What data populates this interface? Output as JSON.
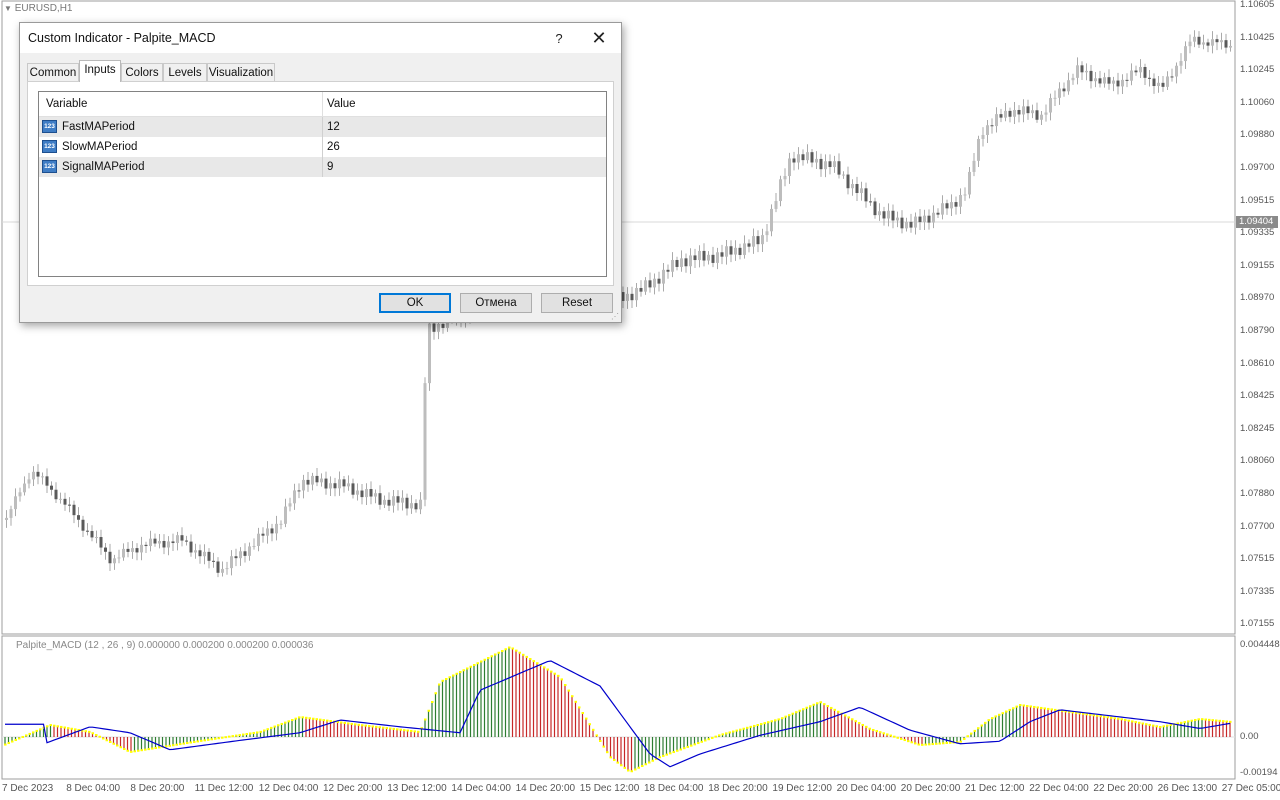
{
  "chart": {
    "symbol": "EURUSD,H1",
    "current_price": "1.09404",
    "price_ticks": [
      "1.10605",
      "1.10425",
      "1.10245",
      "1.10060",
      "1.09880",
      "1.09700",
      "1.09515",
      "1.09335",
      "1.09155",
      "1.08970",
      "1.08790",
      "1.08610",
      "1.08425",
      "1.08245",
      "1.08060",
      "1.07880",
      "1.07700",
      "1.07515",
      "1.07335",
      "1.07155"
    ],
    "time_ticks": [
      "7 Dec 2023",
      "8 Dec 04:00",
      "8 Dec 20:00",
      "11 Dec 12:00",
      "12 Dec 04:00",
      "12 Dec 20:00",
      "13 Dec 12:00",
      "14 Dec 04:00",
      "14 Dec 20:00",
      "15 Dec 12:00",
      "18 Dec 04:00",
      "18 Dec 20:00",
      "19 Dec 12:00",
      "20 Dec 04:00",
      "20 Dec 20:00",
      "21 Dec 12:00",
      "22 Dec 04:00",
      "22 Dec 20:00",
      "26 Dec 13:00",
      "27 Dec 05:00"
    ]
  },
  "indicator": {
    "label": "Palpite_MACD   (12 , 26 , 9) 0.000000 0.000200 0.000200 0.000036",
    "ticks": [
      "0.004448",
      "0.00",
      "-0.00194"
    ],
    "colors": {
      "up_bar": "#2e7d32",
      "down_bar": "#c62828",
      "edge": "#ffff00",
      "signal": "#0000cc"
    }
  },
  "dialog": {
    "title": "Custom Indicator - Palpite_MACD",
    "help_label": "?",
    "close_label": "✕",
    "tabs": [
      "Common",
      "Inputs",
      "Colors",
      "Levels",
      "Visualization"
    ],
    "active_tab": "Inputs",
    "columns": {
      "variable": "Variable",
      "value": "Value"
    },
    "rows": [
      {
        "icon": "123",
        "variable": "FastMAPeriod",
        "value": "12"
      },
      {
        "icon": "123",
        "variable": "SlowMAPeriod",
        "value": "26"
      },
      {
        "icon": "123",
        "variable": "SignalMAPeriod",
        "value": "9"
      }
    ],
    "buttons": {
      "ok": "OK",
      "cancel": "Отмена",
      "reset": "Reset"
    }
  }
}
